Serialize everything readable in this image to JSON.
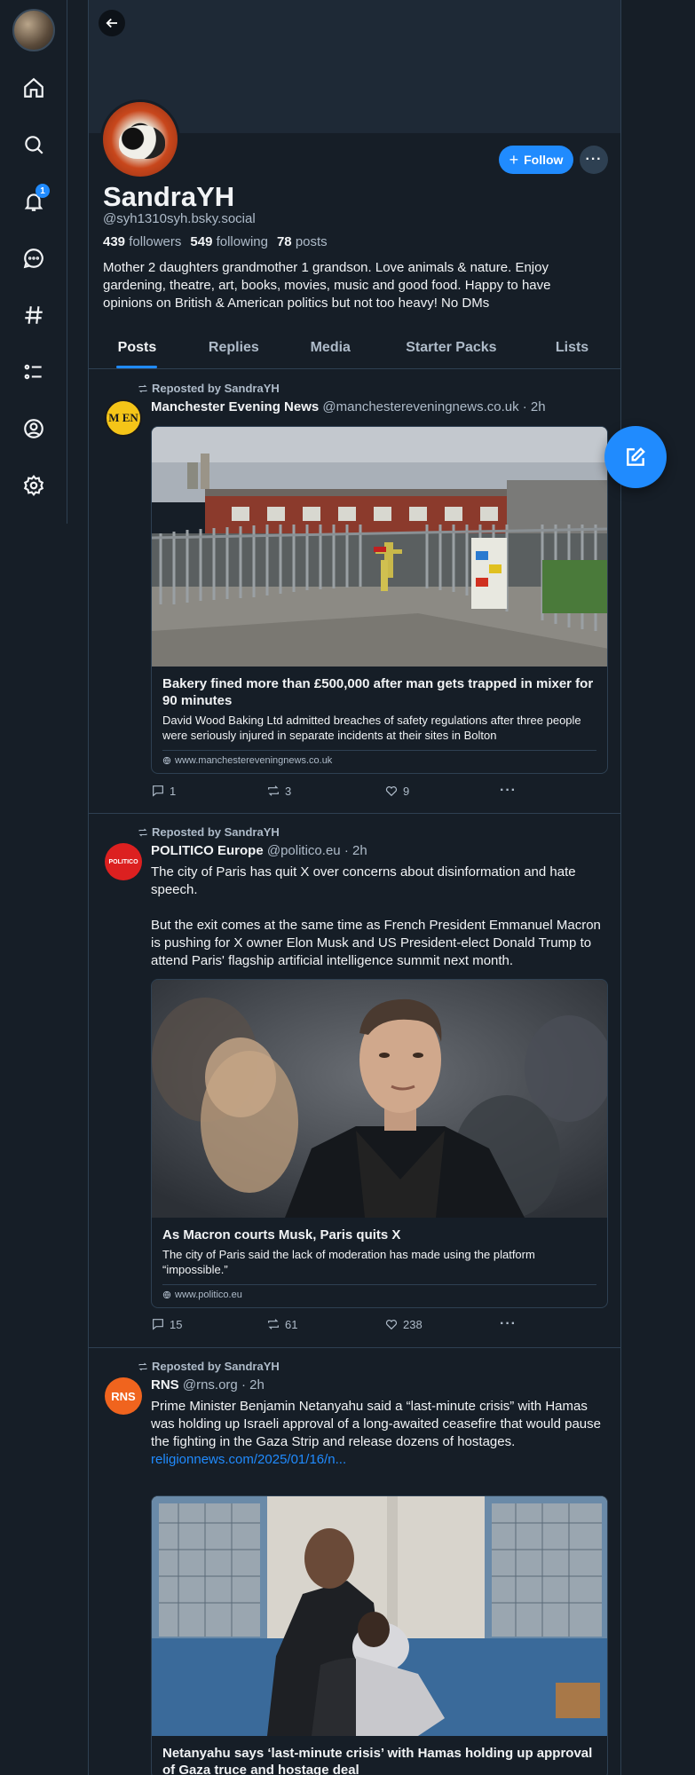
{
  "nav": {
    "notification_count": "1"
  },
  "profile": {
    "display_name": "SandraYH",
    "handle": "@syh1310syh.bsky.social",
    "followers_count": "439",
    "followers_label": "followers",
    "following_count": "549",
    "following_label": "following",
    "posts_count": "78",
    "posts_label": "posts",
    "bio": "Mother  2 daughters grandmother 1 grandson. Love animals & nature. Enjoy gardening, theatre, art, books, movies, music and good food. Happy to have opinions on British & American politics but not too heavy! No DMs",
    "follow_label": "Follow",
    "more_label": "···"
  },
  "tabs": [
    {
      "label": "Posts"
    },
    {
      "label": "Replies"
    },
    {
      "label": "Media"
    },
    {
      "label": "Starter Packs"
    },
    {
      "label": "Lists"
    }
  ],
  "posts": [
    {
      "repost_label": "Reposted by SandraYH",
      "author_name": "Manchester Evening News",
      "author_handle": "@manchestereveningnews.co.uk",
      "time": "· 2h",
      "avatar_text": "M EN",
      "card_title": "Bakery fined more than £500,000 after man gets trapped in mixer for 90 minutes",
      "card_desc": "David Wood Baking Ltd admitted breaches of safety regulations after three people were seriously injured in separate incidents at their sites in Bolton",
      "card_domain": "www.manchestereveningnews.co.uk",
      "replies": "1",
      "reposts": "3",
      "likes": "9"
    },
    {
      "repost_label": "Reposted by SandraYH",
      "author_name": "POLITICO Europe",
      "author_handle": "@politico.eu",
      "time": "· 2h",
      "avatar_text": "POLITICO",
      "text_1": "The city of Paris has quit X over concerns about disinformation and hate speech.",
      "text_2": "But the exit comes at the same time as French President Emmanuel Macron is pushing for X owner Elon Musk and US President-elect Donald Trump to attend Paris' flagship artificial intelligence summit next month.",
      "card_title": "As Macron courts Musk, Paris quits X",
      "card_desc": "The city of Paris said the lack of moderation has made using the platform “impossible.”",
      "card_domain": "www.politico.eu",
      "replies": "15",
      "reposts": "61",
      "likes": "238"
    },
    {
      "repost_label": "Reposted by SandraYH",
      "author_name": "RNS",
      "author_handle": "@rns.org",
      "time": "· 2h",
      "avatar_text": "RNS",
      "text_1": "Prime Minister Benjamin Netanyahu said a “last-minute crisis” with Hamas was holding up Israeli approval of a long-awaited ceasefire that would pause the fighting in the Gaza Strip and release dozens of hostages.",
      "link": "religionnews.com/2025/01/16/n...",
      "card_title": "Netanyahu says ‘last-minute crisis’ with Hamas holding up approval of Gaza truce and hostage deal"
    }
  ],
  "colors": {
    "background": "#161e27",
    "accent": "#208bfe",
    "border": "#2e4052",
    "muted_text": "#aebbc9"
  },
  "icons": [
    "back-arrow-icon",
    "home-icon",
    "search-icon",
    "bell-icon",
    "chat-icon",
    "hashtag-icon",
    "list-icon",
    "profile-icon",
    "settings-icon",
    "compose-icon",
    "repost-icon",
    "reply-icon",
    "like-icon",
    "globe-icon"
  ]
}
